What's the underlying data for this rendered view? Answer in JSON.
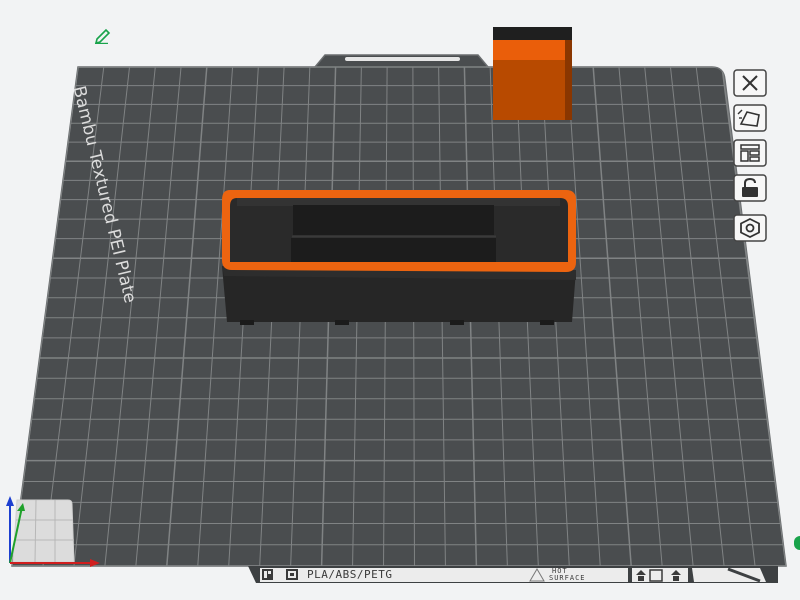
{
  "plate": {
    "name": "Bambu Textured PEI Plate",
    "material_label": "PLA/ABS/PETG",
    "warning_label_line1": "HOT",
    "warning_label_line2": "SURFACE"
  },
  "toolbar": {
    "buttons": [
      {
        "name": "close-icon",
        "title": "Close"
      },
      {
        "name": "edit-plate-icon",
        "title": "Edit plate"
      },
      {
        "name": "arrange-icon",
        "title": "Arrange"
      },
      {
        "name": "lock-icon",
        "title": "Lock"
      },
      {
        "name": "settings-icon",
        "title": "Plate settings"
      }
    ]
  },
  "colors": {
    "plate": "#4a4d4f",
    "grid": "#8a8d8e",
    "model_dark": "#242424",
    "model_accent": "#f26b12",
    "background": "#f2f3f4",
    "selection": "#19a34b"
  }
}
